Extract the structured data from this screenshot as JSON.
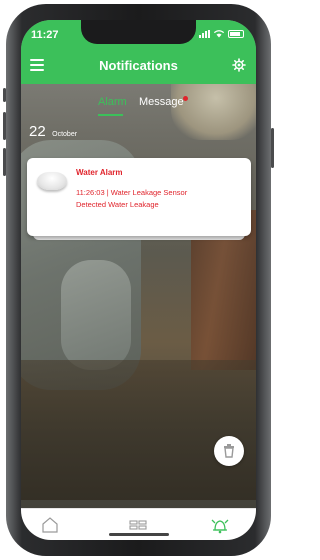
{
  "status_bar": {
    "time": "11:27"
  },
  "header": {
    "title": "Notifications"
  },
  "tabs": [
    {
      "label": "Alarm",
      "active": true
    },
    {
      "label": "Message",
      "active": false,
      "has_unread_dot": true
    }
  ],
  "date_group": {
    "day": "22",
    "month": "October"
  },
  "alarm_card": {
    "title": "Water Alarm",
    "line1": "11:26:03 | Water Leakage Sensor",
    "line2": "Detected Water Leakage"
  },
  "colors": {
    "accent": "#3cc05a",
    "alarm_red": "#e0242c"
  },
  "icons": {
    "menu": "menu-icon",
    "settings": "gear-icon",
    "delete": "trash-icon",
    "nav_home": "home-icon",
    "nav_devices": "devices-icon",
    "nav_alarm": "alarm-bell-icon"
  }
}
